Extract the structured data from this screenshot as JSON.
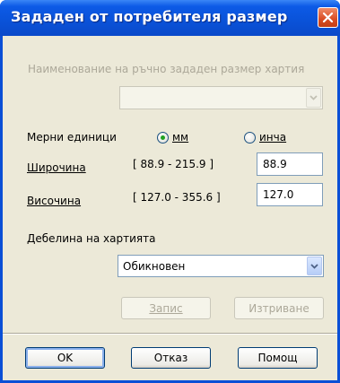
{
  "window": {
    "title": "Зададен от потребителя размер"
  },
  "paper_name": {
    "label": "Наименование на ръчно зададен размер хартия",
    "value": ""
  },
  "units": {
    "label": "Мерни единици",
    "mm_label": "мм",
    "inch_label": "инча",
    "selected": "мм"
  },
  "width": {
    "label": "Широчина",
    "range": "[ 88.9 - 215.9 ]",
    "value": "88.9"
  },
  "height": {
    "label": "Височина",
    "range": "[ 127.0 - 355.6 ]",
    "value": "127.0"
  },
  "thickness": {
    "label": "Дебелина на хартията",
    "value": "Обикновен"
  },
  "actions": {
    "save_label": "Запис",
    "delete_label": "Изтриване"
  },
  "footer": {
    "ok_label": "OK",
    "cancel_label": "Отказ",
    "help_label": "Помощ"
  },
  "colors": {
    "titlebar": "#0a52d8",
    "dialog_bg": "#ece9d8",
    "close_button": "#d84c23",
    "radio_selected": "#21a121",
    "disabled_text": "#aca899"
  },
  "icons": {
    "close": "close-icon",
    "dropdown": "chevron-down-icon"
  }
}
